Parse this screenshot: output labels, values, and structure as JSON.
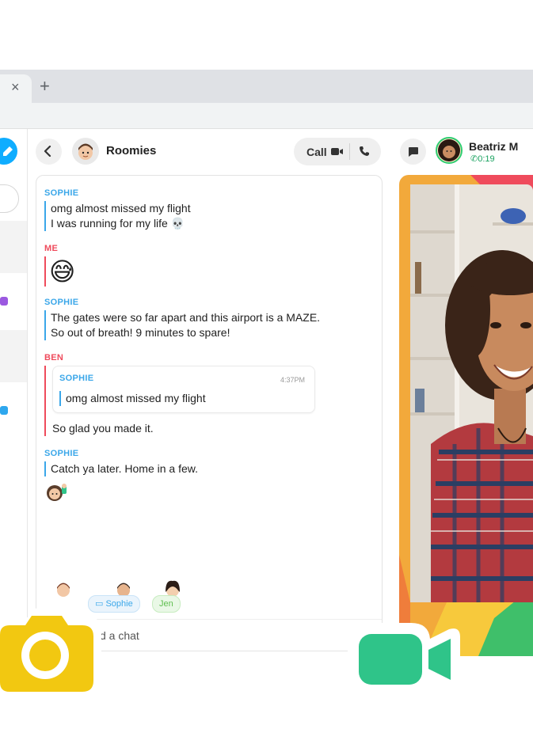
{
  "browser": {
    "tab_close": "×",
    "new_tab": "+"
  },
  "chat": {
    "title": "Roomies",
    "call_label": "Call",
    "composer_placeholder": "d a chat",
    "messages": [
      {
        "sender": "SOPHIE",
        "lines": [
          "omg almost missed my flight",
          "I was running for my life 💀"
        ]
      },
      {
        "sender": "ME",
        "emoji": "😅"
      },
      {
        "sender": "SOPHIE",
        "lines": [
          "The gates were so far apart and this airport is a MAZE.",
          "So out of breath! 9 minutes to spare!"
        ]
      },
      {
        "sender": "BEN",
        "quote": {
          "sender": "SOPHIE",
          "time": "4:37PM",
          "text": "omg almost missed my flight"
        },
        "text": "So glad you made it."
      },
      {
        "sender": "SOPHIE",
        "lines": [
          "Catch ya later. Home in a few."
        ]
      }
    ],
    "typing": [
      {
        "name": "Sophie",
        "icon": "laptop-icon"
      },
      {
        "name": "Jen"
      }
    ]
  },
  "call": {
    "participant_name": "Beatriz M",
    "duration": "0:19"
  },
  "colors": {
    "accent_blue": "#3ba7e9",
    "me_red": "#ef4b5c",
    "camera_yellow": "#f2c811",
    "video_green": "#2fc489"
  }
}
